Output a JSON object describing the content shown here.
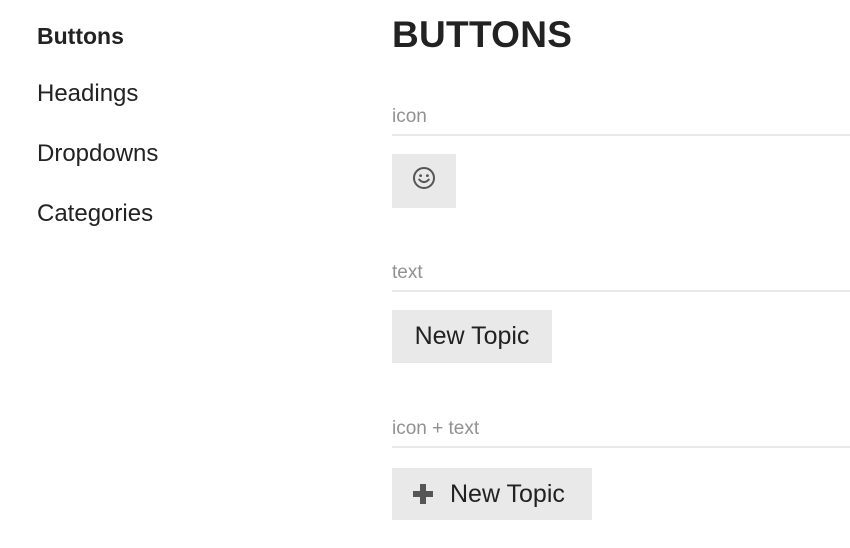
{
  "sidebar": {
    "items": [
      {
        "label": "Buttons",
        "active": true
      },
      {
        "label": "Headings",
        "active": false
      },
      {
        "label": "Dropdowns",
        "active": false
      },
      {
        "label": "Categories",
        "active": false
      }
    ]
  },
  "main": {
    "title": "BUTTONS",
    "sections": [
      {
        "label": "icon",
        "button": {
          "icon": "smile-icon"
        }
      },
      {
        "label": "text",
        "button": {
          "text": "New Topic"
        }
      },
      {
        "label": "icon + text",
        "button": {
          "icon": "plus-icon",
          "text": "New Topic"
        }
      }
    ]
  },
  "colors": {
    "text": "#222222",
    "muted_label": "#919191",
    "button_bg": "#e9e9e9",
    "divider": "#e9e9e9",
    "icon": "#555555"
  }
}
